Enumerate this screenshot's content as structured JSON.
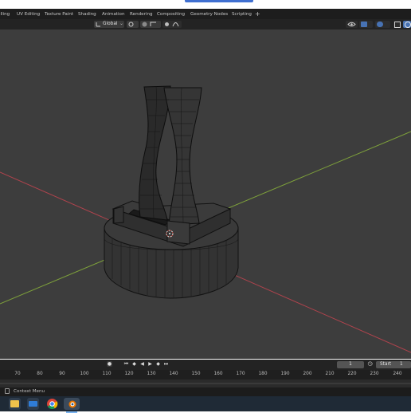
{
  "workspace_tabs": [
    "elling",
    "UV Editing",
    "Texture Paint",
    "Shading",
    "Animation",
    "Rendering",
    "Compositing",
    "Geometry Nodes",
    "Scripting"
  ],
  "add_tab": "+",
  "header": {
    "orientation": "Global"
  },
  "timeline": {
    "current_frame": "1",
    "start_label": "Start",
    "start_value": "1",
    "ticks": [
      "70",
      "80",
      "90",
      "100",
      "110",
      "120",
      "130",
      "140",
      "150",
      "160",
      "170",
      "180",
      "190",
      "200",
      "210",
      "220",
      "230",
      "240"
    ]
  },
  "status": {
    "context_menu": "Context Menu"
  },
  "taskbar": {
    "apps": [
      "file-explorer",
      "mail",
      "chrome",
      "blender"
    ]
  },
  "colors": {
    "viewport_bg": "#3d3d3d",
    "x_axis": "#b0434d",
    "y_axis": "#7ea13b",
    "mesh_wire": "#111111",
    "accent_blue": "#4772b3"
  }
}
